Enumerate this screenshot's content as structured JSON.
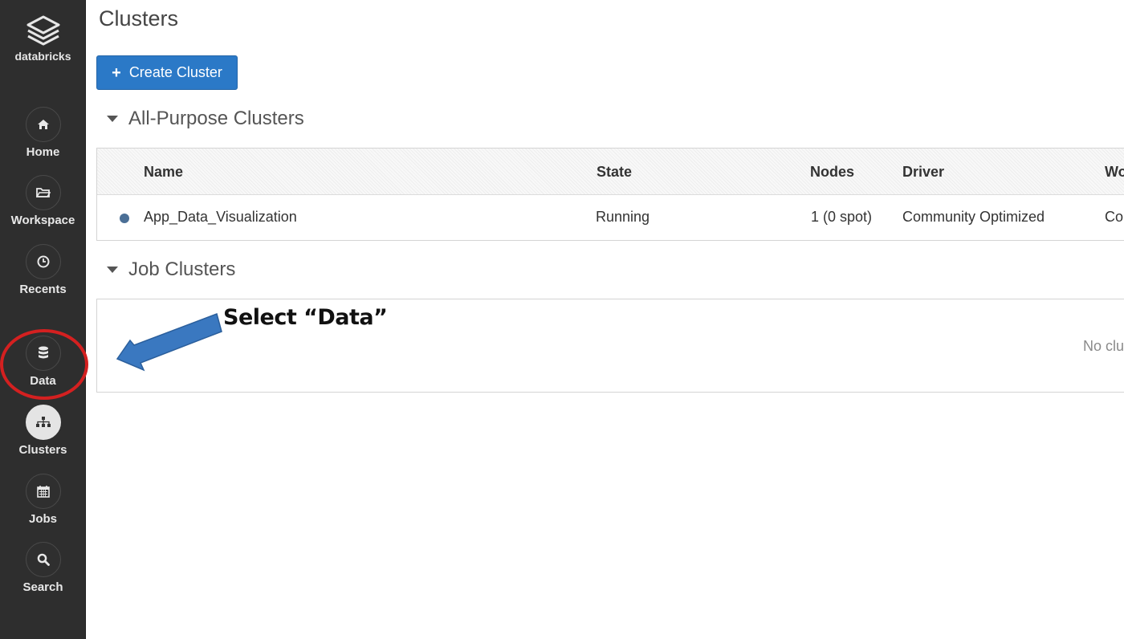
{
  "app": {
    "logo_text": "databricks"
  },
  "sidebar": {
    "items": [
      {
        "label": "Home",
        "icon": "home-icon"
      },
      {
        "label": "Workspace",
        "icon": "folder-icon"
      },
      {
        "label": "Recents",
        "icon": "clock-icon"
      },
      {
        "label": "Data",
        "icon": "database-icon"
      },
      {
        "label": "Clusters",
        "icon": "clusters-icon",
        "active": true
      },
      {
        "label": "Jobs",
        "icon": "calendar-icon"
      },
      {
        "label": "Search",
        "icon": "search-icon"
      }
    ]
  },
  "main": {
    "title": "Clusters",
    "create_button": "Create Cluster",
    "all_purpose": {
      "title": "All-Purpose Clusters",
      "columns": [
        "Name",
        "State",
        "Nodes",
        "Driver",
        "Wo"
      ],
      "rows": [
        {
          "name": "App_Data_Visualization",
          "state": "Running",
          "nodes": "1 (0 spot)",
          "driver": "Community Optimized",
          "worker": "Co"
        }
      ]
    },
    "job_clusters": {
      "title": "Job Clusters",
      "empty_text": "No clu"
    }
  },
  "annotation": {
    "text": "Select “Data”",
    "arrow_color": "#3a78c0",
    "circle_color": "#d42020"
  },
  "colors": {
    "sidebar_bg": "#2e2e2e",
    "primary_button": "#2b79c7",
    "status_running": "#4b6f96"
  }
}
